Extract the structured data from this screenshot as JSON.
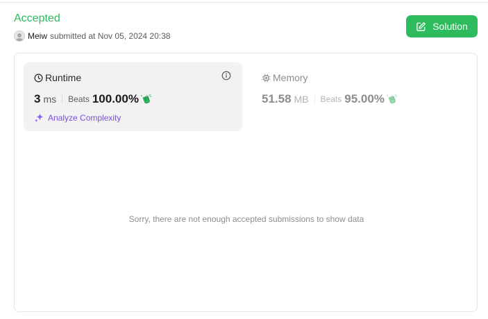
{
  "header": {
    "status": "Accepted",
    "username": "Meiw",
    "submitted_text": "submitted at Nov 05, 2024 20:38",
    "solution_button": "Solution"
  },
  "runtime": {
    "title": "Runtime",
    "value": "3",
    "unit": "ms",
    "beats_label": "Beats",
    "beats_value": "100.00%",
    "analyze_label": "Analyze Complexity"
  },
  "memory": {
    "title": "Memory",
    "value": "51.58",
    "unit": "MB",
    "beats_label": "Beats",
    "beats_value": "95.00%"
  },
  "chart": {
    "empty_message": "Sorry, there are not enough accepted submissions to show data"
  },
  "colors": {
    "accent_green": "#2cbb5d",
    "analyze_purple": "#7a4fd6"
  },
  "icons": {
    "runtime": "clock-icon",
    "memory": "chip-icon",
    "info": "info-icon",
    "solution": "edit-icon",
    "analyze": "sparkle-icon",
    "beats": "clapping-hands-icon"
  }
}
